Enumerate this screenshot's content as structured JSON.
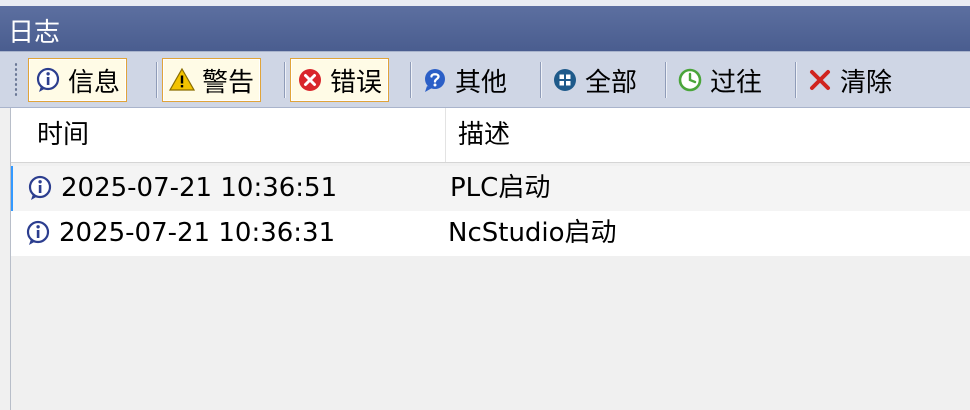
{
  "window": {
    "title": "日志"
  },
  "toolbar": {
    "buttons": [
      {
        "label": "信息",
        "icon": "info-icon",
        "active": true
      },
      {
        "label": "警告",
        "icon": "warning-icon",
        "active": true
      },
      {
        "label": "错误",
        "icon": "error-icon",
        "active": true
      },
      {
        "label": "其他",
        "icon": "question-icon",
        "active": false
      },
      {
        "label": "全部",
        "icon": "all-icon",
        "active": false
      },
      {
        "label": "过往",
        "icon": "history-icon",
        "active": false
      },
      {
        "label": "清除",
        "icon": "clear-icon",
        "active": false
      }
    ]
  },
  "table": {
    "columns": [
      "时间",
      "描述"
    ],
    "rows": [
      {
        "icon": "info-icon",
        "time": "2025-07-21 10:36:51",
        "desc": "PLC启动"
      },
      {
        "icon": "info-icon",
        "time": "2025-07-21 10:36:31",
        "desc": "NcStudio启动"
      }
    ]
  },
  "colors": {
    "titlebar": "#4a5d8f",
    "toolbar": "#cfd6e5",
    "active_border": "#e0a43a",
    "selection_accent": "#3399ff"
  }
}
